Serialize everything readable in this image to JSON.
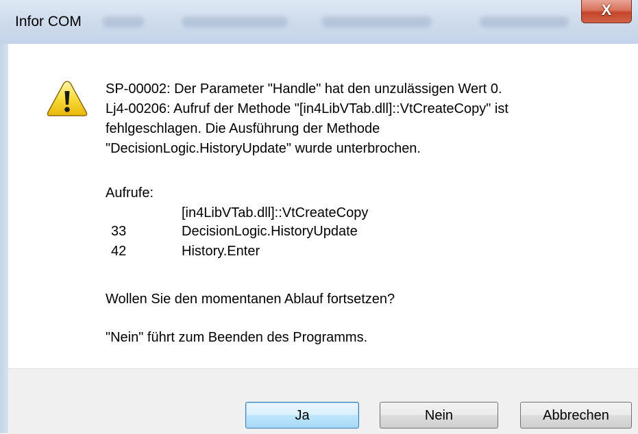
{
  "window": {
    "title": "Infor COM",
    "close_symbol": "X"
  },
  "icon": "warning-icon",
  "message": {
    "lines": [
      "SP-00002: Der Parameter \"Handle\" hat den unzulässigen Wert 0.",
      "Lj4-00206: Aufruf der Methode \"[in4LibVTab.dll]::VtCreateCopy\" ist",
      "fehlgeschlagen. Die Ausführung der Methode",
      "\"DecisionLogic.HistoryUpdate\" wurde unterbrochen."
    ],
    "calls_label": "Aufrufe:",
    "calls": [
      {
        "line": "",
        "name": "[in4LibVTab.dll]::VtCreateCopy"
      },
      {
        "line": "33",
        "name": "DecisionLogic.HistoryUpdate"
      },
      {
        "line": "42",
        "name": "History.Enter"
      }
    ],
    "question": "Wollen Sie den momentanen Ablauf fortsetzen?",
    "note": "\"Nein\" führt zum Beenden des Programms."
  },
  "buttons": {
    "yes": "Ja",
    "no": "Nein",
    "cancel": "Abbrechen"
  },
  "colors": {
    "default_button_border": "#3c7fb1",
    "close_button": "#c2452a",
    "footer_bg": "#f0f0f0"
  }
}
